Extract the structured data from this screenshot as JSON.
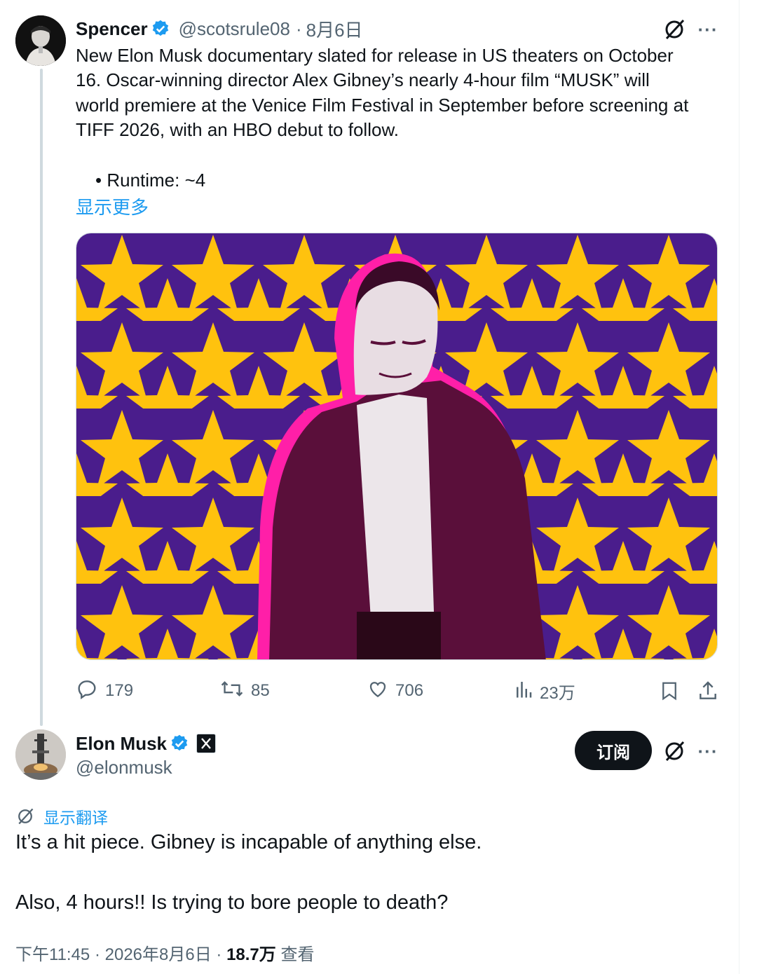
{
  "first_post": {
    "author": {
      "name": "Spencer",
      "handle": "@scotsrule08",
      "separator": "·",
      "date": "8月6日"
    },
    "text_lines": [
      "New Elon Musk documentary slated for release in US theaters on October",
      "16. Oscar-winning director Alex Gibney’s nearly 4-hour film “MUSK” will",
      "world premiere at the Venice Film Festival in September before screening at",
      "TIFF 2026, with an HBO debut to follow."
    ],
    "bullet_text": "• Runtime: ~4",
    "show_more": "显示更多",
    "stats": {
      "replies": "179",
      "reposts": "85",
      "likes": "706",
      "views": "23万"
    }
  },
  "reply_post": {
    "author": {
      "name": "Elon Musk",
      "handle": "@elonmusk"
    },
    "subscribe_label": "订阅",
    "translate_label": "显示翻译",
    "text_lines": [
      "It’s a hit piece. Gibney is incapable of anything else.",
      "Also, 4 hours!! Is trying to bore people to death?"
    ],
    "meta": {
      "time": "下午11:45",
      "separator": "·",
      "date": "2026年8月6日",
      "views_count": "18.7万",
      "views_label": "查看"
    }
  },
  "colors": {
    "accent": "#1d9bf0",
    "secondary_text": "#536471",
    "primary_text": "#0f1419",
    "media_purple": "#4a1d8c",
    "media_star": "#ffc20e",
    "media_pink": "#ff1fa8",
    "media_figure": "#5a0f3a"
  },
  "icons": [
    "verified-badge-icon",
    "grok-icon",
    "more-icon",
    "reply-icon",
    "repost-icon",
    "like-icon",
    "views-icon",
    "bookmark-icon",
    "share-icon",
    "x-logo-icon",
    "translate-icon"
  ]
}
